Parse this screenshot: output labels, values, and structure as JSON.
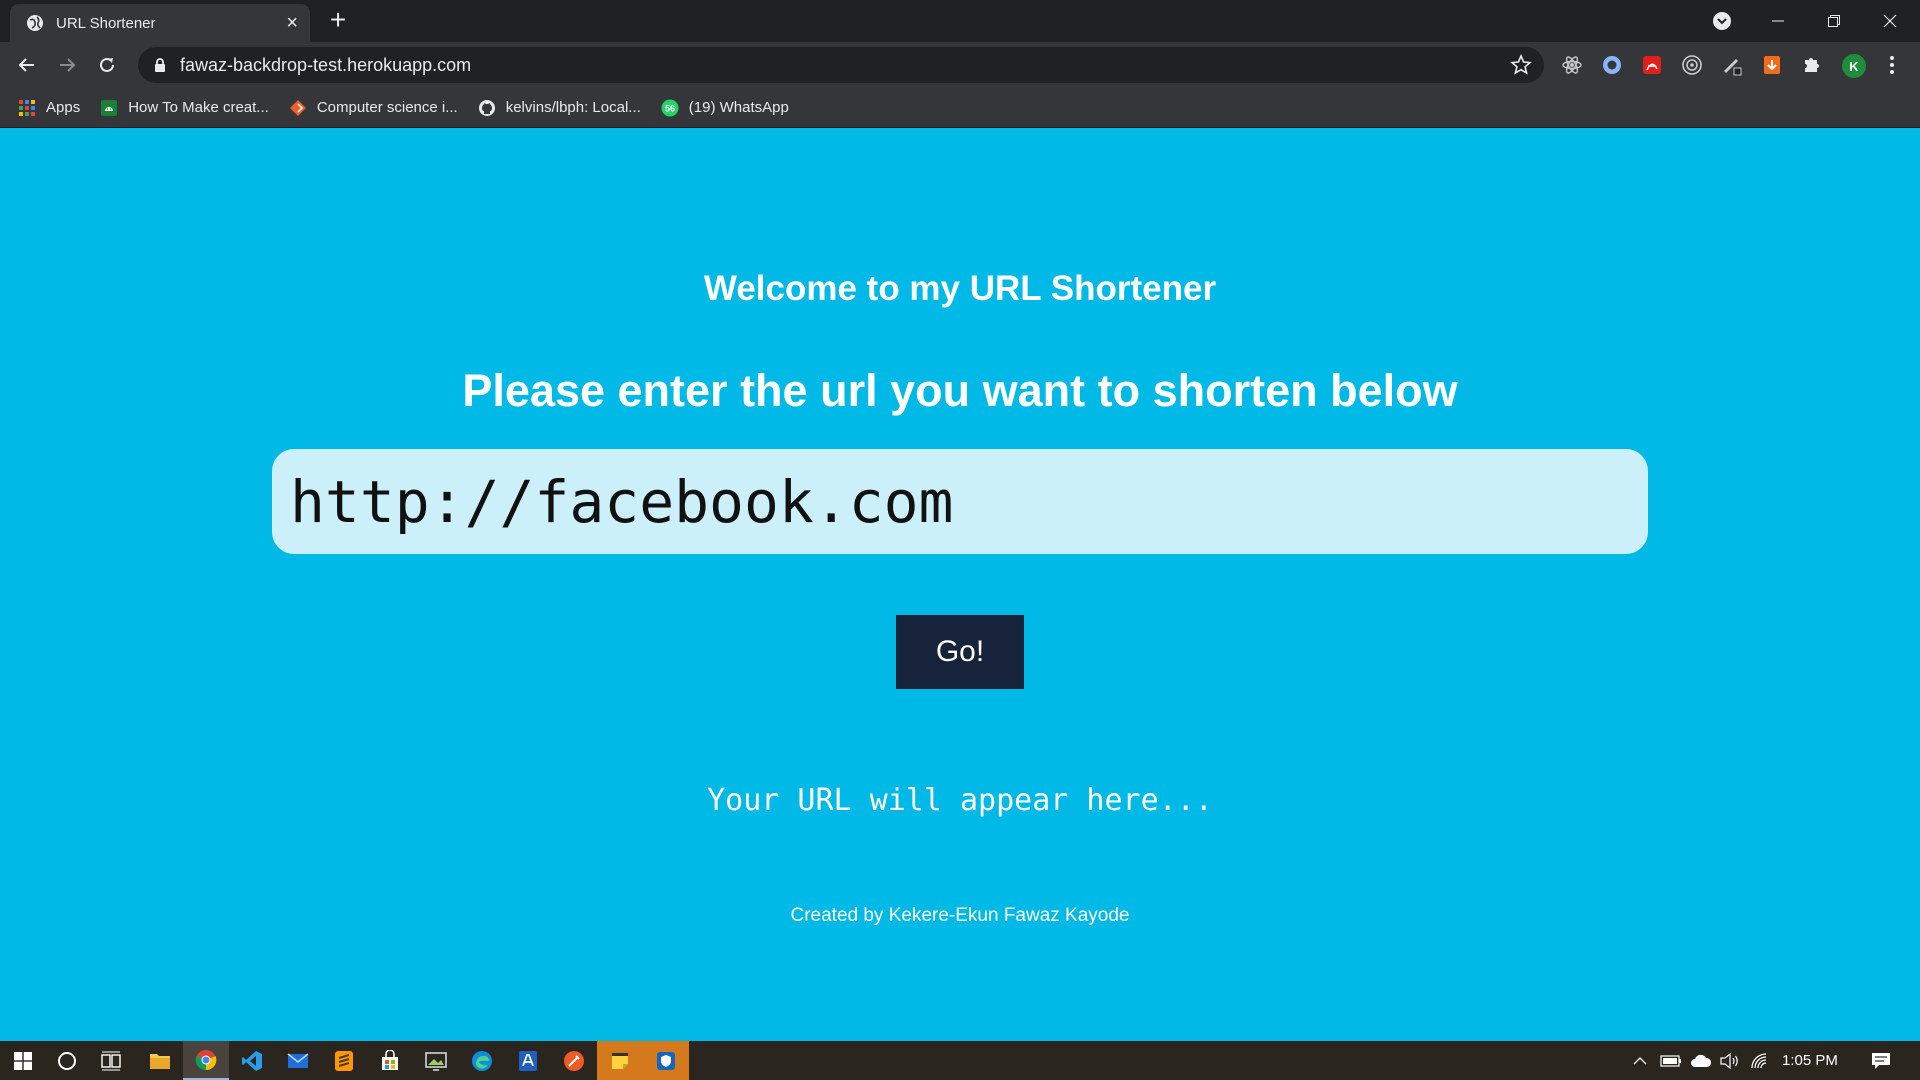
{
  "browser": {
    "tab_title": "URL Shortener",
    "tab_close": "×",
    "new_tab": "+",
    "address_url": "fawaz-backdrop-test.herokuapp.com",
    "profile_initial": "K",
    "bookmarks": [
      {
        "label": "Apps",
        "icon": "apps-grid-icon"
      },
      {
        "label": "How To Make creat...",
        "icon": "android-icon"
      },
      {
        "label": "Computer science i...",
        "icon": "diamond-icon"
      },
      {
        "label": "kelvins/lbph: Local...",
        "icon": "github-icon"
      },
      {
        "label": "(19) WhatsApp",
        "icon": "whatsapp-icon"
      }
    ],
    "whatsapp_badge": "56"
  },
  "page": {
    "welcome": "Welcome to my URL Shortener",
    "prompt": "Please enter the url you want to shorten below",
    "input_value": "http://facebook.com",
    "go_label": "Go!",
    "result_placeholder": "Your URL will appear here...",
    "credit": "Created by Kekere-Ekun Fawaz Kayode"
  },
  "taskbar": {
    "clock": "1:05 PM",
    "apps": [
      "windows-start-icon",
      "cortana-search-icon",
      "task-view-icon",
      "file-explorer-icon",
      "chrome-icon",
      "vscode-icon",
      "mail-icon",
      "sublime-icon",
      "store-icon",
      "photos-icon",
      "edge-icon",
      "azure-data-icon",
      "postman-icon",
      "sticky-notes-icon",
      "security-icon"
    ]
  },
  "colors": {
    "page_bg": "#01b9e6",
    "input_bg": "#ccf0f9",
    "button_bg": "#17233a",
    "chrome_dark": "#202124",
    "chrome_toolbar": "#35363a"
  }
}
